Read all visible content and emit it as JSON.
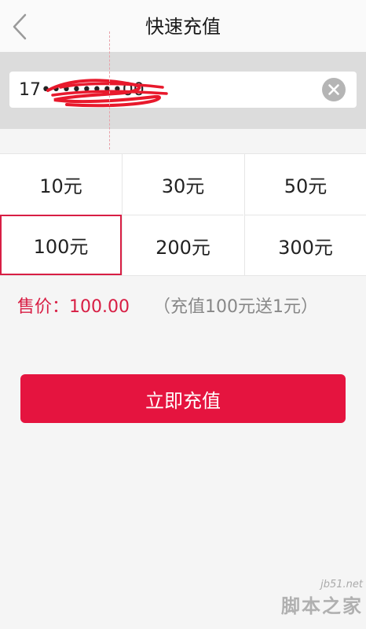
{
  "header": {
    "title": "快速充值",
    "back_icon": "chevron-left-icon"
  },
  "phone": {
    "value": "17••••••••00",
    "clear_icon": "clear-circle-icon"
  },
  "amounts": [
    {
      "label": "10元",
      "selected": false
    },
    {
      "label": "30元",
      "selected": false
    },
    {
      "label": "50元",
      "selected": false
    },
    {
      "label": "100元",
      "selected": true
    },
    {
      "label": "200元",
      "selected": false
    },
    {
      "label": "300元",
      "selected": false
    }
  ],
  "price": {
    "label": "售价：",
    "value": "100.00",
    "note": "（充值100元送1元）"
  },
  "submit": {
    "label": "立即充值"
  },
  "watermark": {
    "url": "jb51.net",
    "name": "脚本之家"
  },
  "colors": {
    "accent": "#e5143f",
    "selected_border": "#d81e44",
    "price_text": "#d81e44",
    "note_text": "#888888",
    "phone_bar_bg": "#dcdcdc",
    "page_bg": "#f5f5f5"
  }
}
